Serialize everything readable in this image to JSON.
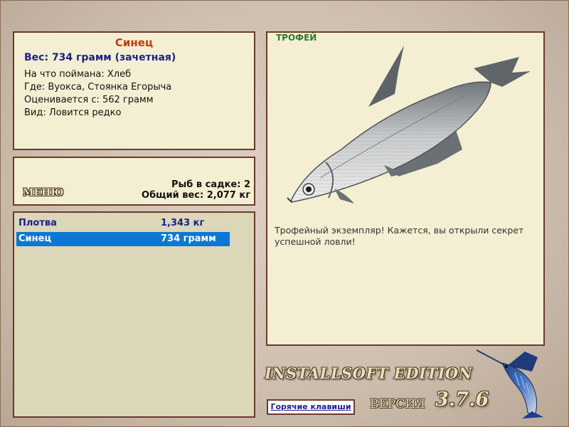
{
  "fish_info": {
    "title": "Синец",
    "weight": "Вес: 734 грамм (зачетная)",
    "bait": "На что поймана: Хлеб",
    "location": "Где: Вуокса, Стоянка Егорыча",
    "rated_from": "Оценивается с: 562 грамм",
    "kind": "Вид: Ловится редко"
  },
  "menu": {
    "menu_label": "МЕНЮ",
    "fish_count": "Рыб в садке: 2",
    "total_weight": "Общий вес: 2,077 кг"
  },
  "catch_list": [
    {
      "name": "Плотва",
      "weight": "1,343 кг",
      "selected": false
    },
    {
      "name": "Синец",
      "weight": "734 грамм",
      "selected": true
    }
  ],
  "trophy": {
    "tag": "ТРОФЕЙ",
    "description": "Трофейный экземпляр! Кажется, вы открыли секрет успешной ловли!"
  },
  "footer": {
    "edition": "INSTALLSOFT EDITION",
    "version_label": "ВЕРСИЯ",
    "version_number": "3.7.6",
    "hotkeys_label": "Горячие клавиши"
  },
  "colors": {
    "selected_row": "#0b78d4",
    "title_color": "#c23c12",
    "accent_blue": "#1b1f8e",
    "trophy_green": "#2f7a2a"
  }
}
